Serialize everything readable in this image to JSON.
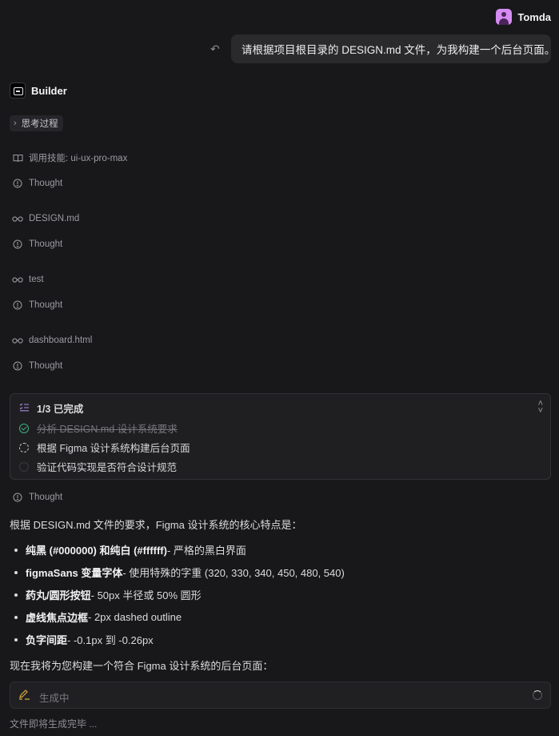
{
  "user": {
    "name": "Tomda",
    "avatar_icon": "user-icon"
  },
  "message": {
    "text": "请根据项目根目录的 DESIGN.md 文件，为我构建一个后台页面。",
    "undo_icon": "undo-icon"
  },
  "assistant": {
    "name": "Builder",
    "logo_icon": "terminal-icon"
  },
  "thinking_toggle": {
    "label": "思考过程",
    "icon": "chevron-right-icon"
  },
  "steps": [
    {
      "icon": "book-open-icon",
      "label": "调用技能: ui-ux-pro-max"
    },
    {
      "icon": "lightbulb-icon",
      "label": "Thought"
    },
    {
      "icon": "glasses-icon",
      "label": "DESIGN.md"
    },
    {
      "icon": "lightbulb-icon",
      "label": "Thought"
    },
    {
      "icon": "glasses-icon",
      "label": "test"
    },
    {
      "icon": "lightbulb-icon",
      "label": "Thought"
    },
    {
      "icon": "glasses-icon",
      "label": "dashboard.html"
    },
    {
      "icon": "lightbulb-icon",
      "label": "Thought"
    }
  ],
  "todo": {
    "title": "1/3 已完成",
    "progress": {
      "done": 1,
      "total": 3
    },
    "items": [
      {
        "label": "分析 DESIGN.md 设计系统要求",
        "status": "done"
      },
      {
        "label": "根据 Figma 设计系统构建后台页面",
        "status": "in-progress"
      },
      {
        "label": "验证代码实现是否符合设计规范",
        "status": "pending"
      }
    ]
  },
  "thought_after": {
    "icon": "lightbulb-icon",
    "label": "Thought"
  },
  "response": {
    "intro": "根据 DESIGN.md 文件的要求，Figma 设计系统的核心特点是：",
    "bullets": [
      {
        "strong": "纯黑 (#000000) 和纯白 (#ffffff)",
        "rest": " - 严格的黑白界面"
      },
      {
        "strong": "figmaSans 变量字体",
        "rest": " - 使用特殊的字重 (320, 330, 340, 450, 480, 540)"
      },
      {
        "strong": "药丸/圆形按钮",
        "rest": " - 50px 半径或 50% 圆形"
      },
      {
        "strong": "虚线焦点边框",
        "rest": " - 2px dashed outline"
      },
      {
        "strong": "负字间距",
        "rest": " - -0.1px 到 -0.26px"
      }
    ],
    "outro": "现在我将为您构建一个符合 Figma 设计系统的后台页面："
  },
  "generating": {
    "label": "生成中",
    "icon": "edit-pen-icon",
    "footer": "文件即将生成完毕 ..."
  },
  "colors": {
    "background": "#18181a",
    "success": "#3fb27f",
    "accent_pen": "#d6a93c",
    "avatar": "#d58cf2"
  }
}
